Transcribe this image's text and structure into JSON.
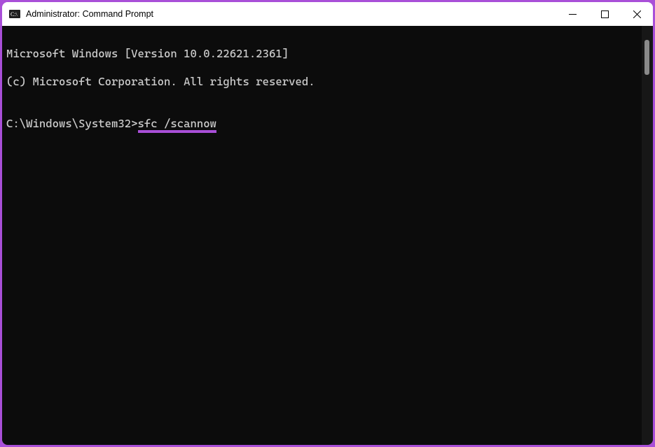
{
  "titlebar": {
    "title": "Administrator: Command Prompt"
  },
  "console": {
    "line1": "Microsoft Windows [Version 10.0.22621.2361]",
    "line2": "(c) Microsoft Corporation. All rights reserved.",
    "blank": "",
    "prompt": "C:\\Windows\\System32>",
    "command": "sfc /scannow"
  },
  "accent_color": "#a94fd8"
}
